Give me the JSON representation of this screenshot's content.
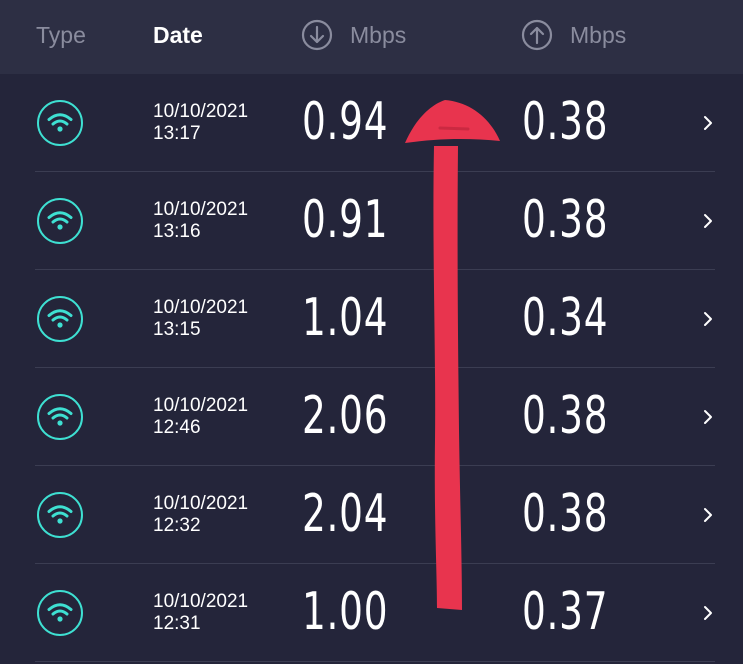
{
  "header": {
    "type_label": "Type",
    "date_label": "Date",
    "download_label": "Mbps",
    "upload_label": "Mbps"
  },
  "colors": {
    "accent": "#3ee0d2",
    "background": "#24253a",
    "header_bg": "#2d2f44",
    "annotation_arrow": "#e8344e"
  },
  "icons": {
    "connection_type": "wifi-icon",
    "download": "arrow-down-circle-icon",
    "upload": "arrow-up-circle-icon",
    "row_action": "chevron-right-icon"
  },
  "rows": [
    {
      "date": "10/10/2021",
      "time": "13:17",
      "download": "0.94",
      "upload": "0.38"
    },
    {
      "date": "10/10/2021",
      "time": "13:16",
      "download": "0.91",
      "upload": "0.38"
    },
    {
      "date": "10/10/2021",
      "time": "13:15",
      "download": "1.04",
      "upload": "0.34"
    },
    {
      "date": "10/10/2021",
      "time": "12:46",
      "download": "2.06",
      "upload": "0.38"
    },
    {
      "date": "10/10/2021",
      "time": "12:32",
      "download": "2.04",
      "upload": "0.38"
    },
    {
      "date": "10/10/2021",
      "time": "12:31",
      "download": "1.00",
      "upload": "0.37"
    }
  ]
}
